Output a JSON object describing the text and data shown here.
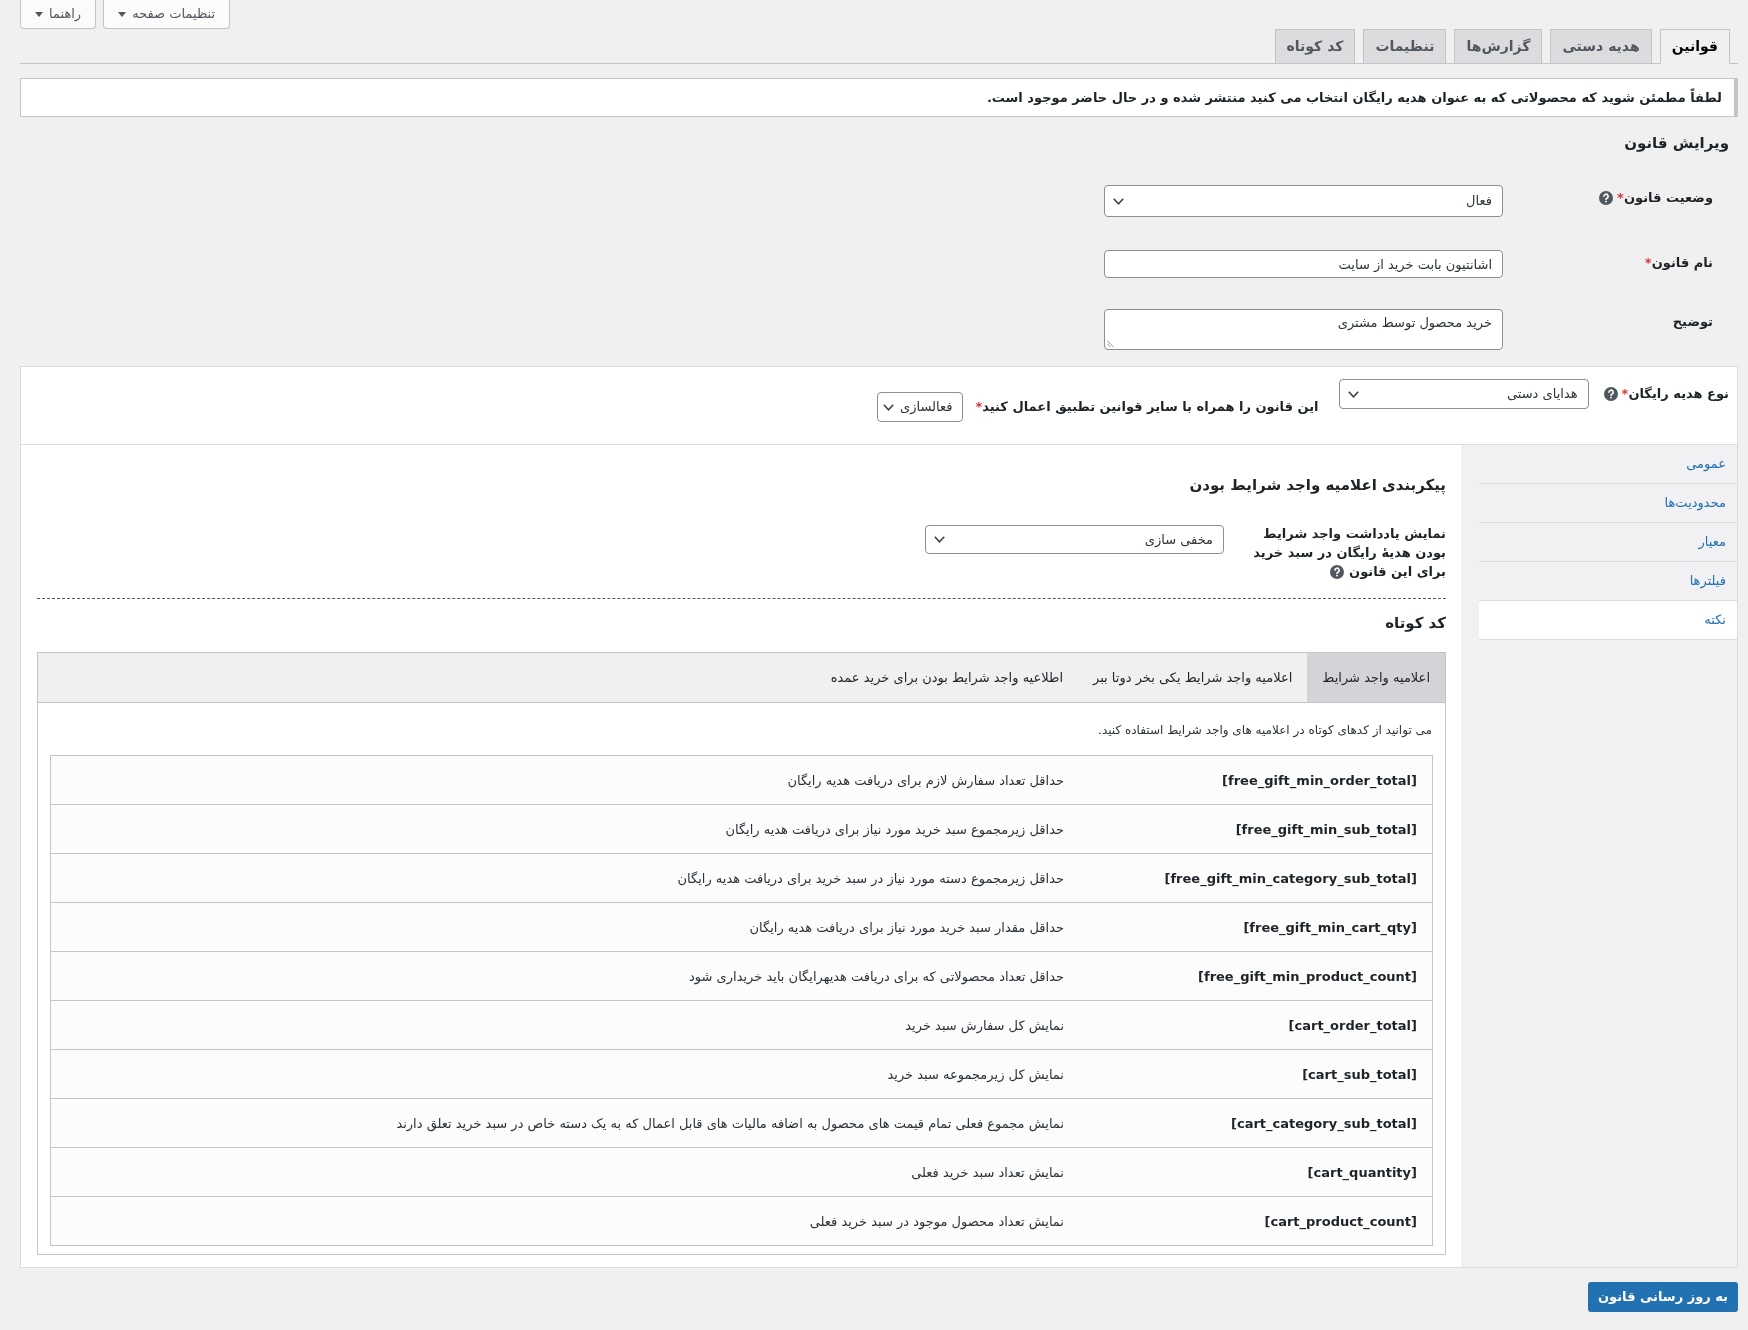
{
  "screen_meta_buttons": [
    "تنظیمات صفحه",
    "راهنما"
  ],
  "nav_tabs": [
    {
      "label": "قوانین",
      "selected": true
    },
    {
      "label": "هدیه دستی",
      "selected": false
    },
    {
      "label": "گزارش‌ها",
      "selected": false
    },
    {
      "label": "تنظیمات",
      "selected": false
    },
    {
      "label": "کد کوتاه",
      "selected": false
    }
  ],
  "notice": "لطفاً مطمئن شوید که محصولاتی که به عنوان هدیه رایگان انتخاب می کنید منتشر شده و در حال حاضر موجود است.",
  "section_title": "ویرایش قانون",
  "fields": [
    {
      "kind": "select",
      "label": "وضعیت قانون",
      "required_mark": "*",
      "help": true,
      "value": "فعال"
    },
    {
      "kind": "text",
      "label": "نام قانون",
      "required_mark": "*",
      "value": "اشانتیون بابت خرید از سایت"
    },
    {
      "kind": "textarea",
      "label": "توضیح",
      "value": "خرید محصول توسط مشتری"
    }
  ],
  "rule_options": {
    "gift_type": {
      "label": "نوع هدیه رایگان",
      "required_mark": "*",
      "help": true,
      "value": "هدایای دستی"
    },
    "combine_rules": {
      "label": "این قانون را همراه با سایر قوانین تطبیق اعمال کنید",
      "required_mark": "*",
      "value": "فعالسازی"
    }
  },
  "side_tabs": [
    {
      "label": "عمومی",
      "selected": false
    },
    {
      "label": "محدودیت‌ها",
      "selected": false
    },
    {
      "label": "معیار",
      "selected": false
    },
    {
      "label": "فیلترها",
      "selected": false
    },
    {
      "label": "نکته",
      "selected": true
    }
  ],
  "notice_settings": {
    "title": "پیکربندی اعلامیه واجد شرایط بودن",
    "field": {
      "label": "نمایش یادداشت واجد شرایط بودن هدیهٔ رایگان در سبد خرید برای این قانون",
      "help": true,
      "value": "مخفی سازی"
    }
  },
  "shortcodes": {
    "title": "کد کوتاه",
    "tabs": [
      {
        "label": "اعلامیه واجد شرایط",
        "selected": true
      },
      {
        "label": "اعلامیه واجد شرایط یکی بخر دوتا ببر",
        "selected": false
      },
      {
        "label": "اطلاعیه واجد شرایط بودن برای خرید عمده",
        "selected": false
      }
    ],
    "hint": "می توانید از کدهای کوتاه در اعلامیه های واجد شرایط استفاده کنید.",
    "rows": [
      {
        "code": "[free_gift_min_order_total]",
        "description": "حداقل تعداد سفارش لازم برای دریافت هدیه رایگان"
      },
      {
        "code": "[free_gift_min_sub_total]",
        "description": "حداقل زیرمجموع سبد خرید مورد نیاز برای دریافت هدیه رایگان"
      },
      {
        "code": "[free_gift_min_category_sub_total]",
        "description": "حداقل زیرمجموع دسته مورد نیاز در سبد خرید برای دریافت هدیه رایگان"
      },
      {
        "code": "[free_gift_min_cart_qty]",
        "description": "حداقل مقدار سبد خرید مورد نیاز برای دریافت هدیه رایگان"
      },
      {
        "code": "[free_gift_min_product_count]",
        "description": "حداقل تعداد محصولاتی که برای دریافت هدیهرایگان باید خریداری شود"
      },
      {
        "code": "[cart_order_total]",
        "description": "نمایش کل سفارش سبد خرید"
      },
      {
        "code": "[cart_sub_total]",
        "description": "نمایش کل زیرمجموعه سبد خرید"
      },
      {
        "code": "[cart_category_sub_total]",
        "description": "نمایش مجموع فعلی تمام قیمت های محصول به اضافه مالیات های قابل اعمال که به یک دسته خاص در سبد خرید تعلق دارند"
      },
      {
        "code": "[cart_quantity]",
        "description": "نمایش تعداد سبد خرید فعلی"
      },
      {
        "code": "[cart_product_count]",
        "description": "نمایش تعداد محصول موجود در سبد خرید فعلی"
      }
    ]
  },
  "update_button": "به روز رسانی قانون"
}
